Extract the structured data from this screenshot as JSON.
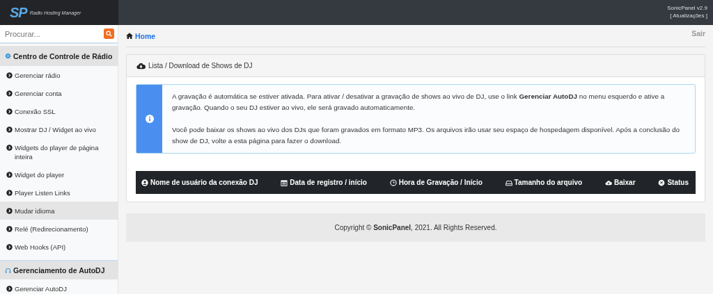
{
  "header": {
    "logo_mark": "SP",
    "logo_tagline": "Radio Hosting Manager",
    "version": "SonicPanel v2.9",
    "updates_link": "[ Atualizações ]"
  },
  "sidebar": {
    "search": {
      "placeholder": "Procurar..."
    },
    "sections": [
      {
        "title": "Centro de Controle de Rádio",
        "items": [
          {
            "label": "Gerenciar rádio",
            "selected": false
          },
          {
            "label": "Gerenciar conta",
            "selected": false
          },
          {
            "label": "Conexão SSL",
            "selected": false
          },
          {
            "label": "Mostrar DJ / Widget ao vivo",
            "selected": false
          },
          {
            "label": "Widgets do player de página inteira",
            "selected": false
          },
          {
            "label": "Widget do player",
            "selected": false
          },
          {
            "label": "Player Listen Links",
            "selected": false
          },
          {
            "label": "Mudar idioma",
            "selected": true
          },
          {
            "label": "Relé (Redirecionamento)",
            "selected": false
          },
          {
            "label": "Web Hooks (API)",
            "selected": false
          }
        ]
      },
      {
        "title": "Gerenciamento de AutoDJ",
        "items": [
          {
            "label": "Gerenciar AutoDJ",
            "selected": false
          }
        ]
      }
    ]
  },
  "breadcrumb": {
    "home": "Home"
  },
  "logout": "Sair",
  "panel": {
    "title": "Lista / Download de Shows de DJ",
    "alert": [
      "A gravação é automática se estiver ativada. Para ativar / desativar a gravação de shows ao vivo de DJ, use o link **Gerenciar AutoDJ** no menu esquerdo e ative a gravação. Quando o seu DJ estiver ao vivo, ele será gravado automaticamente.",
      "Você pode baixar os shows ao vivo dos DJs que foram gravados em formato MP3. Os arquivos irão usar seu espaço de hospedagem disponível. Após a conclusão do show de DJ, volte a esta página para fazer o download."
    ],
    "table": {
      "columns": [
        "Nome de usuário da conexão DJ",
        "Data de registro / início",
        "Hora de Gravação / Início",
        "Tamanho do arquivo",
        "Baixar",
        "Status"
      ]
    }
  },
  "footer": "Copyright © **SonicPanel**, 2021. All Rights Reserved."
}
